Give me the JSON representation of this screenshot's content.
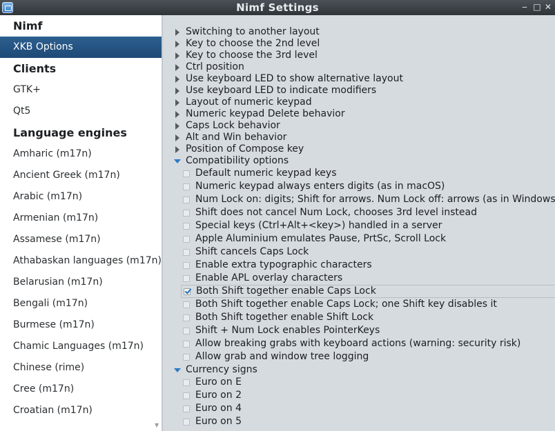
{
  "window": {
    "title": "Nimf Settings",
    "controls": {
      "minimize": "‒",
      "maximize": "□",
      "close": "✕"
    }
  },
  "sidebar": {
    "items": [
      {
        "type": "header",
        "label": "Nimf"
      },
      {
        "type": "item",
        "label": "XKB Options",
        "active": true
      },
      {
        "type": "header",
        "label": "Clients"
      },
      {
        "type": "item",
        "label": "GTK+"
      },
      {
        "type": "item",
        "label": "Qt5"
      },
      {
        "type": "header",
        "label": "Language engines"
      },
      {
        "type": "item",
        "label": "Amharic (m17n)"
      },
      {
        "type": "item",
        "label": "Ancient Greek (m17n)"
      },
      {
        "type": "item",
        "label": "Arabic (m17n)"
      },
      {
        "type": "item",
        "label": "Armenian (m17n)"
      },
      {
        "type": "item",
        "label": "Assamese (m17n)"
      },
      {
        "type": "item",
        "label": "Athabaskan languages (m17n)"
      },
      {
        "type": "item",
        "label": "Belarusian (m17n)"
      },
      {
        "type": "item",
        "label": "Bengali (m17n)"
      },
      {
        "type": "item",
        "label": "Burmese (m17n)"
      },
      {
        "type": "item",
        "label": "Chamic Languages (m17n)"
      },
      {
        "type": "item",
        "label": "Chinese (rime)"
      },
      {
        "type": "item",
        "label": "Cree (m17n)"
      },
      {
        "type": "item",
        "label": "Croatian (m17n)"
      }
    ]
  },
  "content": {
    "rows": [
      {
        "type": "category",
        "label": "Switching to another layout",
        "expanded": false
      },
      {
        "type": "category",
        "label": "Key to choose the 2nd level",
        "expanded": false
      },
      {
        "type": "category",
        "label": "Key to choose the 3rd level",
        "expanded": false
      },
      {
        "type": "category",
        "label": "Ctrl position",
        "expanded": false
      },
      {
        "type": "category",
        "label": "Use keyboard LED to show alternative layout",
        "expanded": false
      },
      {
        "type": "category",
        "label": "Use keyboard LED to indicate modifiers",
        "expanded": false
      },
      {
        "type": "category",
        "label": "Layout of numeric keypad",
        "expanded": false
      },
      {
        "type": "category",
        "label": "Numeric keypad Delete behavior",
        "expanded": false
      },
      {
        "type": "category",
        "label": "Caps Lock behavior",
        "expanded": false
      },
      {
        "type": "category",
        "label": "Alt and Win behavior",
        "expanded": false
      },
      {
        "type": "category",
        "label": "Position of Compose key",
        "expanded": false
      },
      {
        "type": "category",
        "label": "Compatibility options",
        "expanded": true
      },
      {
        "type": "option",
        "label": "Default numeric keypad keys",
        "checked": false
      },
      {
        "type": "option",
        "label": "Numeric keypad always enters digits (as in macOS)",
        "checked": false
      },
      {
        "type": "option",
        "label": "Num Lock on: digits; Shift for arrows. Num Lock off: arrows (as in Windows)",
        "checked": false
      },
      {
        "type": "option",
        "label": "Shift does not cancel Num Lock, chooses 3rd level instead",
        "checked": false
      },
      {
        "type": "option",
        "label": "Special keys (Ctrl+Alt+<key>) handled in a server",
        "checked": false
      },
      {
        "type": "option",
        "label": "Apple Aluminium emulates Pause, PrtSc, Scroll Lock",
        "checked": false
      },
      {
        "type": "option",
        "label": "Shift cancels Caps Lock",
        "checked": false
      },
      {
        "type": "option",
        "label": "Enable extra typographic characters",
        "checked": false
      },
      {
        "type": "option",
        "label": "Enable APL overlay characters",
        "checked": false
      },
      {
        "type": "option",
        "label": "Both Shift together enable Caps Lock",
        "checked": true,
        "focused": true
      },
      {
        "type": "option",
        "label": "Both Shift together enable Caps Lock; one Shift key disables it",
        "checked": false
      },
      {
        "type": "option",
        "label": "Both Shift together enable Shift Lock",
        "checked": false
      },
      {
        "type": "option",
        "label": "Shift + Num Lock enables PointerKeys",
        "checked": false
      },
      {
        "type": "option",
        "label": "Allow breaking grabs with keyboard actions (warning: security risk)",
        "checked": false
      },
      {
        "type": "option",
        "label": "Allow grab and window tree logging",
        "checked": false
      },
      {
        "type": "category",
        "label": "Currency signs",
        "expanded": true
      },
      {
        "type": "option",
        "label": "Euro on E",
        "checked": false
      },
      {
        "type": "option",
        "label": "Euro on 2",
        "checked": false
      },
      {
        "type": "option",
        "label": "Euro on 4",
        "checked": false
      },
      {
        "type": "option",
        "label": "Euro on 5",
        "checked": false
      }
    ]
  }
}
